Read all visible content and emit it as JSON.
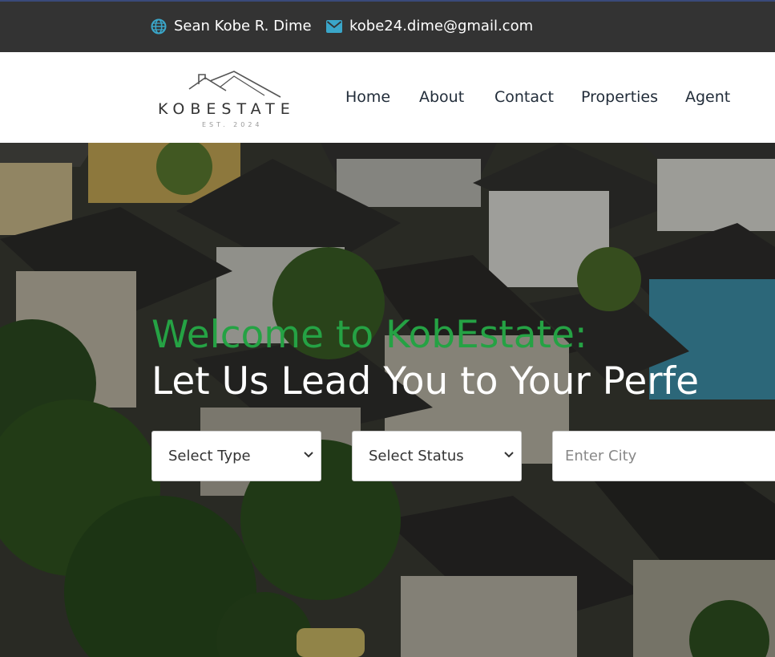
{
  "topbar": {
    "name": "Sean Kobe R. Dime",
    "name_icon": "globe-icon",
    "email": "kobe24.dime@gmail.com",
    "email_icon": "envelope-icon",
    "icon_color": "#3aa6c9"
  },
  "logo": {
    "brand": "KOBESTATE",
    "tagline": "EST. 2024"
  },
  "nav": {
    "items": [
      "Home",
      "About",
      "Contact",
      "Properties",
      "Agent"
    ]
  },
  "hero": {
    "headline_green": "Welcome to KobEstate:",
    "headline_white": "Let Us Lead You to Your Perfe",
    "accent_color": "#25a244",
    "type_select": "Select Type",
    "status_select": "Select Status",
    "city_placeholder": "Enter City"
  }
}
